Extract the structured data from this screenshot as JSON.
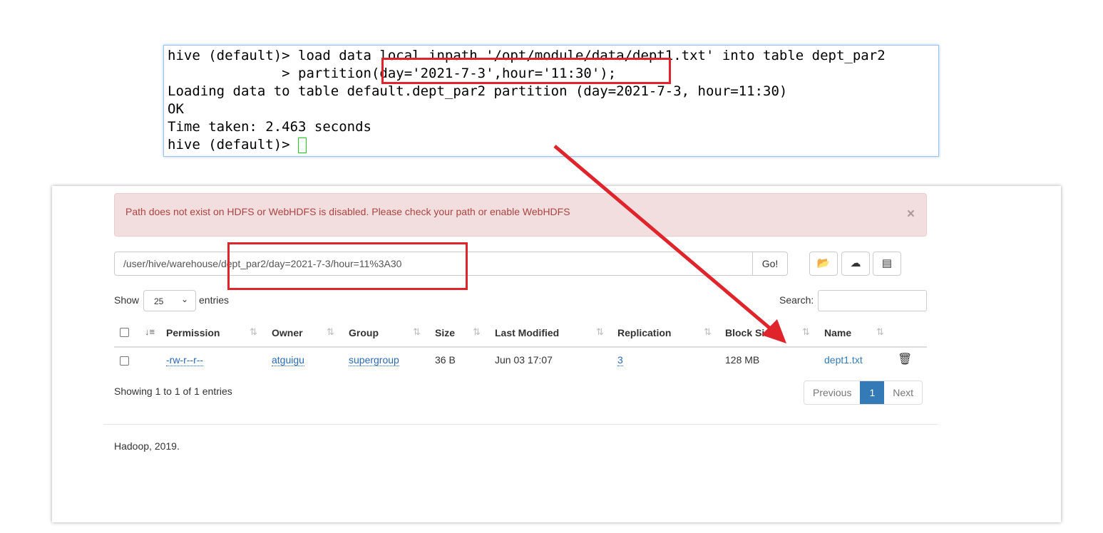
{
  "terminal": {
    "lines": [
      "hive (default)> load data local inpath '/opt/module/data/dept1.txt' into table dept_par2",
      "              > partition(day='2021-7-3',hour='11:30');",
      "Loading data to table default.dept_par2 partition (day=2021-7-3, hour=11:30)",
      "OK",
      "Time taken: 2.463 seconds",
      "hive (default)> "
    ]
  },
  "alert": {
    "message": "Path does not exist on HDFS or WebHDFS is disabled. Please check your path or enable WebHDFS",
    "close": "×"
  },
  "browser": {
    "path": "/user/hive/warehouse/dept_par2/day=2021-7-3/hour=11%3A30",
    "go": "Go!",
    "icons": [
      "folder-icon",
      "upload-icon",
      "list-icon"
    ]
  },
  "entries": {
    "show": "Show",
    "value": "25",
    "suffix": "entries",
    "search_label": "Search:"
  },
  "table": {
    "headers": [
      "Permission",
      "Owner",
      "Group",
      "Size",
      "Last Modified",
      "Replication",
      "Block Size",
      "Name"
    ],
    "rows": [
      {
        "permission": "-rw-r--r--",
        "owner": "atguigu",
        "group": "supergroup",
        "size": "36 B",
        "modified": "Jun 03 17:07",
        "replication": "3",
        "block_size": "128 MB",
        "name": "dept1.txt"
      }
    ]
  },
  "info": "Showing 1 to 1 of 1 entries",
  "pagination": {
    "previous": "Previous",
    "current": "1",
    "next": "Next"
  },
  "footer": "Hadoop, 2019.",
  "colors": {
    "annotation": "#e0242b",
    "link": "#337ab7",
    "alert_bg": "#f2dede"
  }
}
